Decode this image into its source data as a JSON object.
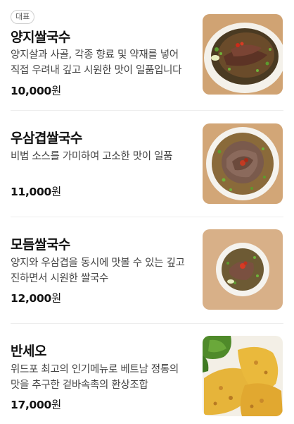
{
  "menu": {
    "items": [
      {
        "badge": "대표",
        "name": "양지쌀국수",
        "description": "양지살과 사골, 각종 향료 및 약재를 넣어 직접 우려내 깊고 시원한 맛이 일품입니다",
        "price": "10,000",
        "currency": "원",
        "image_icon": "beef-pho-bowl-photo"
      },
      {
        "name": "우삼겹쌀국수",
        "description": "비법 소스를 가미하여 고소한 맛이 일품",
        "price": "11,000",
        "currency": "원",
        "image_icon": "brisket-pho-bowl-photo"
      },
      {
        "name": "모듬쌀국수",
        "description": "양지와 우삼겹을 동시에 맛볼 수 있는 깊고 진하면서 시원한 쌀국수",
        "price": "12,000",
        "currency": "원",
        "image_icon": "combo-pho-bowl-photo"
      },
      {
        "name": "반세오",
        "description": "위드포 최고의 인기메뉴로 베트남 정통의 맛을 추구한 겉바속촉의 환상조합",
        "price": "17,000",
        "currency": "원",
        "image_icon": "banh-xeo-pancake-photo"
      }
    ]
  },
  "colors": {
    "background": "#ffffff",
    "text_primary": "#111111",
    "text_secondary": "#444444",
    "divider": "#ededed",
    "badge_border": "#cfcfcf"
  }
}
